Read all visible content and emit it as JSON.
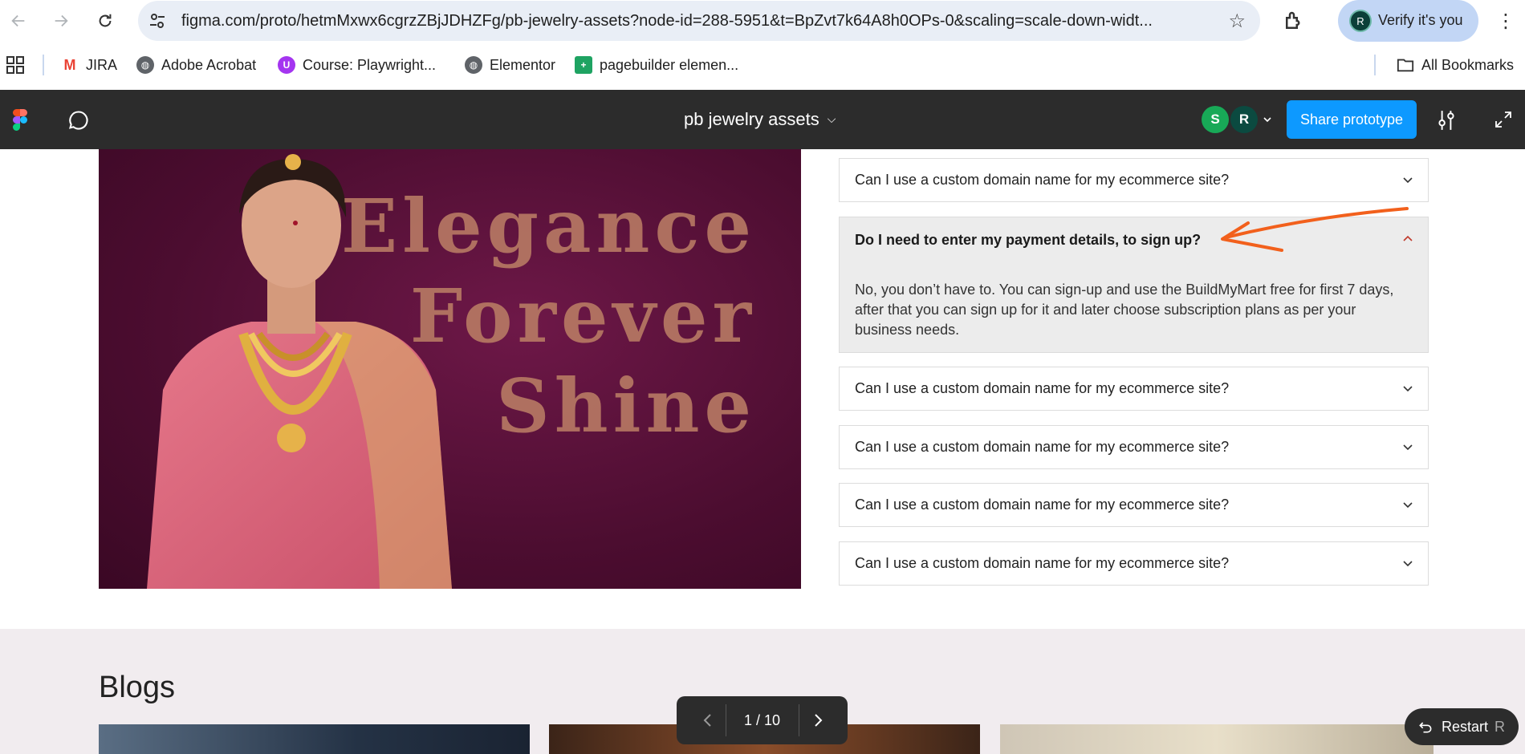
{
  "browser": {
    "url": "figma.com/proto/hetmMxwx6cgrzZBjJDHZFg/pb-jewelry-assets?node-id=288-5951&t=BpZvt7k64A8h0OPs-0&scaling=scale-down-widt...",
    "verify_label": "Verify it's you",
    "profile_initial": "R"
  },
  "bookmarks": {
    "items": [
      {
        "label": "JIRA"
      },
      {
        "label": "Adobe Acrobat"
      },
      {
        "label": "Course: Playwright..."
      },
      {
        "label": "Elementor"
      },
      {
        "label": "pagebuilder elemen..."
      }
    ],
    "all_label": "All Bookmarks"
  },
  "figma": {
    "file_title": "pb jewelry assets",
    "avatars": [
      {
        "initial": "S",
        "color": "#18a957"
      },
      {
        "initial": "R",
        "color": "#0b4a40"
      }
    ],
    "share_label": "Share prototype"
  },
  "hero": {
    "lines": [
      "Elegance",
      "Forever",
      "Shine"
    ]
  },
  "faq": {
    "items": [
      {
        "question": "Can I use a custom domain name for my ecommerce site?",
        "open": false
      },
      {
        "question": "Do I need to enter my payment details, to sign up?",
        "open": true,
        "answer": "No, you don’t have to. You can sign-up and use the BuildMyMart free for first 7 days, after that you can  sign up for it and later choose subscription plans as per your business needs."
      },
      {
        "question": "Can I use a custom domain name for my ecommerce site?",
        "open": false
      },
      {
        "question": "Can I use a custom domain name for my ecommerce site?",
        "open": false
      },
      {
        "question": "Can I use a custom domain name for my ecommerce site?",
        "open": false
      },
      {
        "question": "Can I use a custom domain name for my ecommerce site?",
        "open": false
      }
    ]
  },
  "blogs": {
    "title": "Blogs"
  },
  "pager": {
    "count": "1 / 10"
  },
  "restart": {
    "label": "Restart",
    "initial": "R"
  },
  "colors": {
    "annotation_arrow": "#f2601c",
    "share": "#0d99ff",
    "toolbar": "#2c2c2c"
  }
}
